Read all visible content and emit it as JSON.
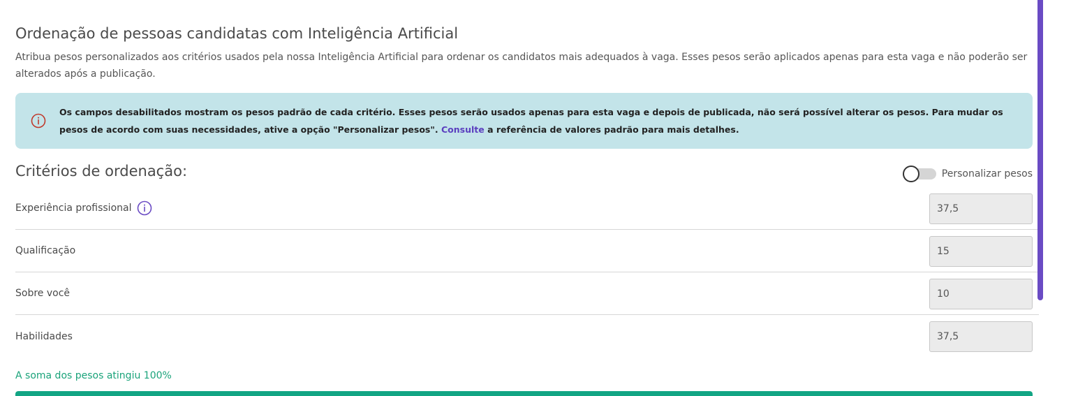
{
  "header": {
    "title": "Ordenação de pessoas candidatas com Inteligência Artificial",
    "description": "Atribua pesos personalizados aos critérios usados pela nossa Inteligência Artificial para ordenar os candidatos mais adequados à vaga. Esses pesos serão aplicados apenas para esta vaga e não poderão ser alterados após a publicação."
  },
  "alert": {
    "text_before_link": "Os campos desabilitados mostram os pesos padrão de cada critério. Esses pesos serão usados apenas para esta vaga e depois de publicada, não será possível alterar os pesos. Para mudar os pesos de acordo com suas necessidades, ative a opção \"Personalizar pesos\".",
    "link_text": "Consulte",
    "text_after_link": "a referência de valores padrão para mais detalhes.",
    "icon": "alert-circle-icon",
    "color": "#c3e4e9"
  },
  "criteria_section": {
    "title": "Critérios de ordenação:",
    "toggle_label": "Personalizar pesos",
    "toggle_on": false
  },
  "criteria": [
    {
      "label": "Experiência profissional",
      "value": "37,5",
      "has_info": true
    },
    {
      "label": "Qualificação",
      "value": "15",
      "has_info": false
    },
    {
      "label": "Sobre você",
      "value": "10",
      "has_info": false
    },
    {
      "label": "Habilidades",
      "value": "37,5",
      "has_info": false
    }
  ],
  "summary": {
    "message": "A soma dos pesos atingiu 100%",
    "progress": 1.0,
    "color": "#12a584"
  },
  "colors": {
    "accent": "#6a4bc4",
    "success": "#1aa37a",
    "alert_icon": "#c0392b"
  }
}
